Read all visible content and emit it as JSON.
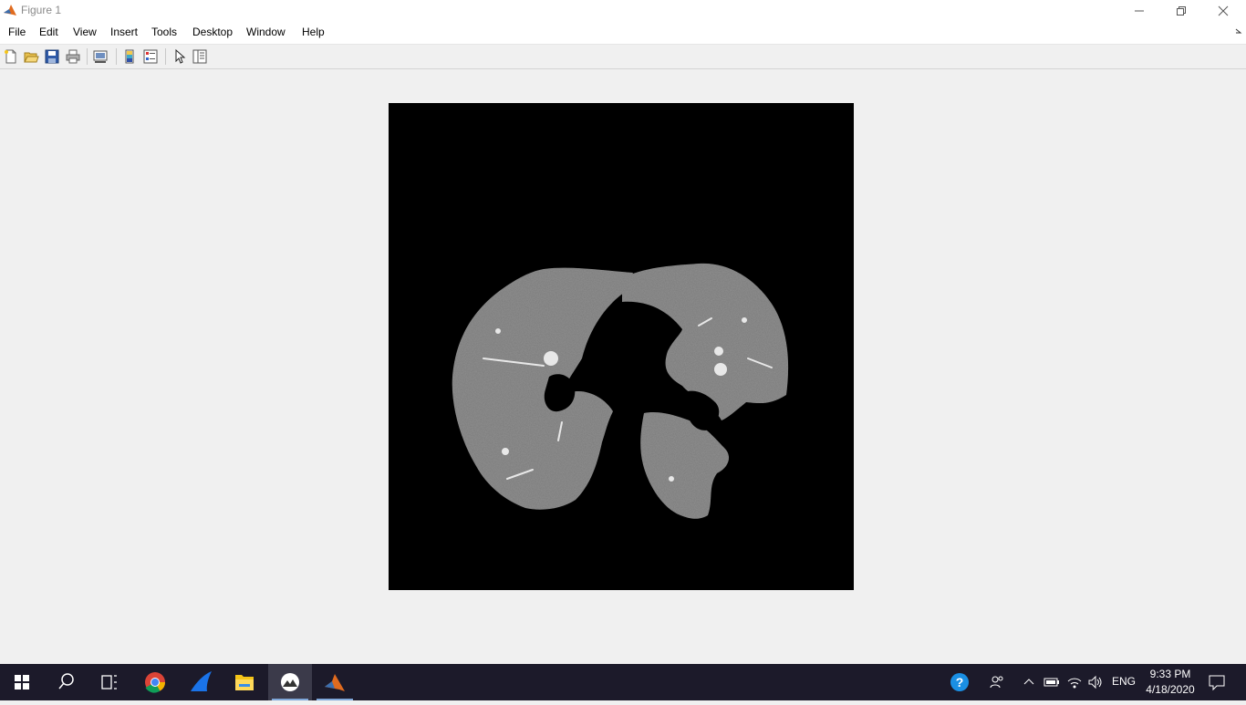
{
  "window": {
    "title": "Figure 1",
    "icon": "matlab-icon"
  },
  "menu": {
    "items": [
      {
        "label": "File",
        "name": "menu-file"
      },
      {
        "label": "Edit",
        "name": "menu-edit"
      },
      {
        "label": "View",
        "name": "menu-view"
      },
      {
        "label": "Insert",
        "name": "menu-insert"
      },
      {
        "label": "Tools",
        "name": "menu-tools"
      },
      {
        "label": "Desktop",
        "name": "menu-desktop"
      },
      {
        "label": "Window",
        "name": "menu-window"
      },
      {
        "label": "Help",
        "name": "menu-help"
      }
    ]
  },
  "toolbar": {
    "icons": [
      "new-figure-icon",
      "open-file-icon",
      "save-figure-icon",
      "print-figure-icon",
      "link-plot-icon",
      "insert-colorbar-icon",
      "insert-legend-icon",
      "edit-plot-icon",
      "plot-tools-icon"
    ]
  },
  "figure": {
    "content": "lung-ct-slice-image",
    "background_color": "#000000",
    "tissue_color": "#7a7a7a"
  },
  "taskbar": {
    "apps": [
      "windows-start-icon",
      "search-icon",
      "task-view-icon",
      "chrome-icon",
      "shark-app-icon",
      "file-explorer-icon",
      "photos-app-icon",
      "matlab-icon"
    ],
    "tray": {
      "language": "ENG",
      "time": "9:33 PM",
      "date": "4/18/2020"
    }
  },
  "colors": {
    "taskbar": "#1c1a2a",
    "window_bg": "#f0f0f0",
    "accent": "#0078d7"
  }
}
